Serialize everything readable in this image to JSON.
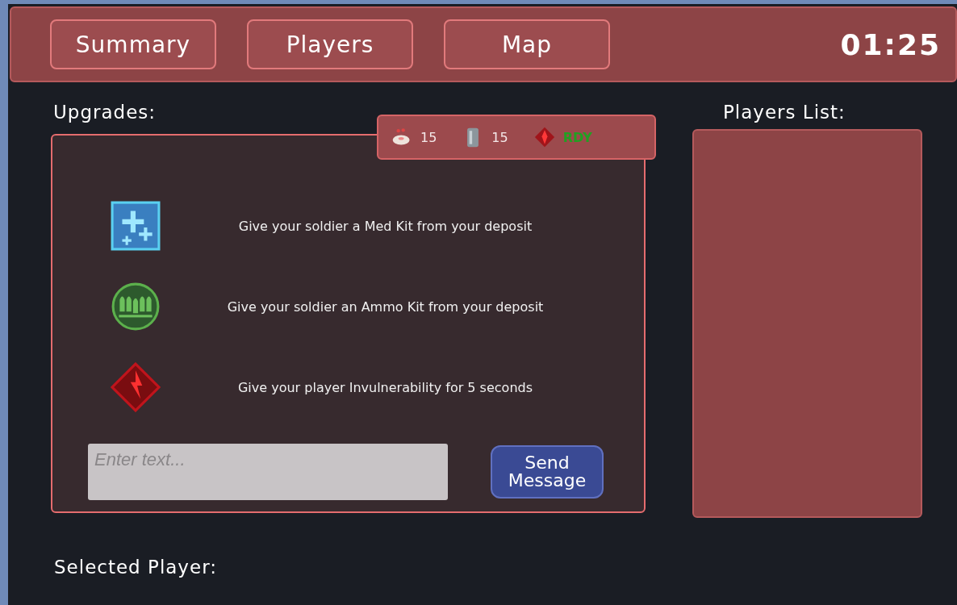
{
  "tabs": [
    {
      "label": "Summary"
    },
    {
      "label": "Players"
    },
    {
      "label": "Map"
    }
  ],
  "timer": "01:25",
  "upgrades": {
    "title": "Upgrades:",
    "resources": [
      {
        "kind": "medkit",
        "value": "15"
      },
      {
        "kind": "battery",
        "value": "15"
      },
      {
        "kind": "power",
        "value": "RDY"
      }
    ],
    "items": [
      {
        "kind": "medkit",
        "text": "Give your soldier a Med Kit from your deposit"
      },
      {
        "kind": "ammo",
        "text": "Give your soldier an Ammo Kit from your deposit"
      },
      {
        "kind": "power",
        "text": "Give your player Invulnerability for 5 seconds"
      }
    ],
    "message": {
      "placeholder": "Enter text..."
    },
    "send_button": "Send Message"
  },
  "players_list": {
    "title": "Players List:"
  },
  "selected_player": {
    "label": "Selected Player:"
  }
}
